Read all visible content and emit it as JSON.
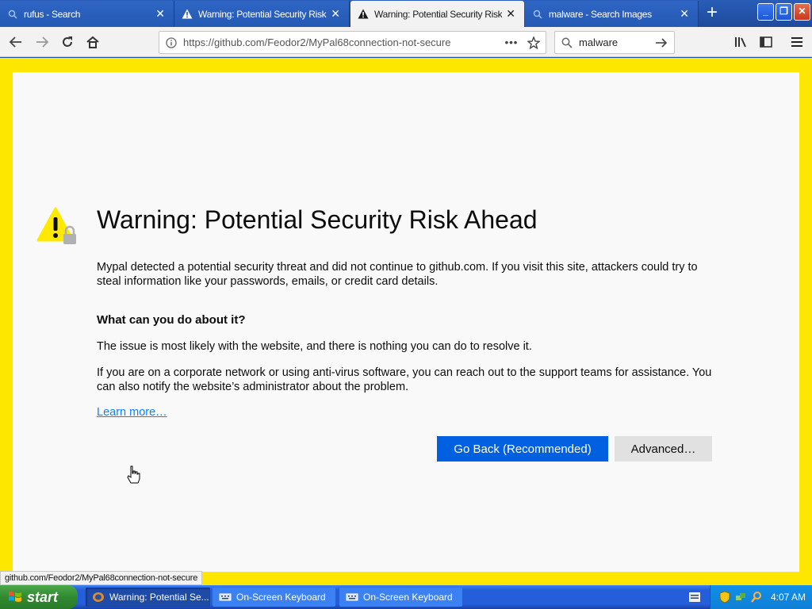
{
  "browser": {
    "tabs": [
      {
        "label": "rufus - Search",
        "icon": "search-icon",
        "active": false
      },
      {
        "label": "Warning: Potential Security Risk Ahead",
        "icon": "warning-icon",
        "active": false
      },
      {
        "label": "Warning: Potential Security Risk Ahead",
        "icon": "warning-icon",
        "active": true
      },
      {
        "label": "malware - Search Images",
        "icon": "search-icon",
        "active": false
      }
    ],
    "new_tab_glyph": "+",
    "window_controls": {
      "minimize": "_",
      "restore": "❐",
      "close": "✕"
    },
    "url": "https://github.com/Feodor2/MyPal68connection-not-secure",
    "search_value": "malware",
    "accent": "#0060df",
    "frame_color": "#fde600"
  },
  "page": {
    "title": "Warning: Potential Security Risk Ahead",
    "intro": "Mypal detected a potential security threat and did not continue to github.com. If you visit this site, attackers could try to steal information like your passwords, emails, or credit card details.",
    "what_heading": "What can you do about it?",
    "para1": "The issue is most likely with the website, and there is nothing you can do to resolve it.",
    "para2": "If you are on a corporate network or using anti-virus software, you can reach out to the support teams for assistance. You can also notify the website’s administrator about the problem.",
    "learn_more": "Learn more…",
    "go_back": "Go Back (Recommended)",
    "advanced": "Advanced…"
  },
  "status_text": "github.com/Feodor2/MyPal68connection-not-secure",
  "taskbar": {
    "start": "start",
    "tasks": [
      {
        "label": "Warning: Potential Se...",
        "active": true
      },
      {
        "label": "On-Screen Keyboard",
        "active": false
      },
      {
        "label": "On-Screen Keyboard",
        "active": false
      }
    ],
    "clock": "4:07 AM"
  }
}
